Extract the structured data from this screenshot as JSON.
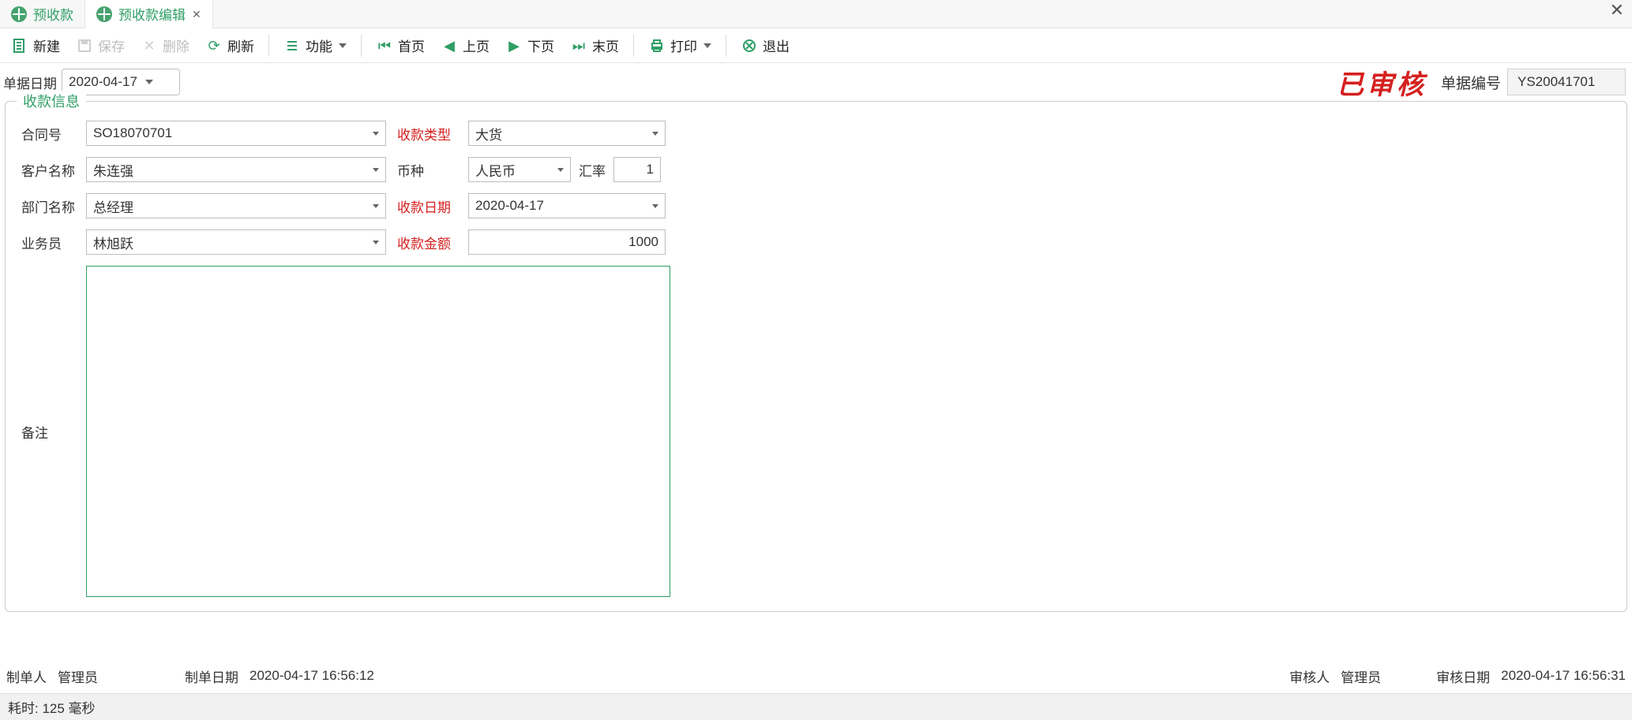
{
  "tabs": [
    {
      "label": "预收款",
      "active": false
    },
    {
      "label": "预收款编辑",
      "active": true
    }
  ],
  "toolbar": {
    "new_label": "新建",
    "save_label": "保存",
    "delete_label": "删除",
    "refresh_label": "刷新",
    "function_label": "功能",
    "first_label": "首页",
    "prev_label": "上页",
    "next_label": "下页",
    "last_label": "末页",
    "print_label": "打印",
    "exit_label": "退出"
  },
  "header": {
    "doc_date_label": "单据日期",
    "doc_date_value": "2020-04-17",
    "approved_text": "已审核",
    "doc_no_label": "单据编号",
    "doc_no_value": "YS20041701"
  },
  "fieldset": {
    "legend": "收款信息",
    "labels": {
      "contract_no": "合同号",
      "receipt_type": "收款类型",
      "customer_name": "客户名称",
      "currency": "币种",
      "rate": "汇率",
      "dept_name": "部门名称",
      "receipt_date": "收款日期",
      "salesman": "业务员",
      "receipt_amount": "收款金额",
      "remark": "备注"
    },
    "values": {
      "contract_no": "SO18070701",
      "receipt_type": "大货",
      "customer_name": "朱连强",
      "currency": "人民币",
      "rate": "1",
      "dept_name": "总经理",
      "receipt_date": "2020-04-17",
      "salesman": "林旭跃",
      "receipt_amount": "1000",
      "remark": ""
    }
  },
  "footer": {
    "creator_label": "制单人",
    "creator_value": "管理员",
    "create_date_label": "制单日期",
    "create_date_value": "2020-04-17 16:56:12",
    "auditor_label": "审核人",
    "auditor_value": "管理员",
    "audit_date_label": "审核日期",
    "audit_date_value": "2020-04-17 16:56:31"
  },
  "status": {
    "text": "耗时: 125 毫秒"
  }
}
